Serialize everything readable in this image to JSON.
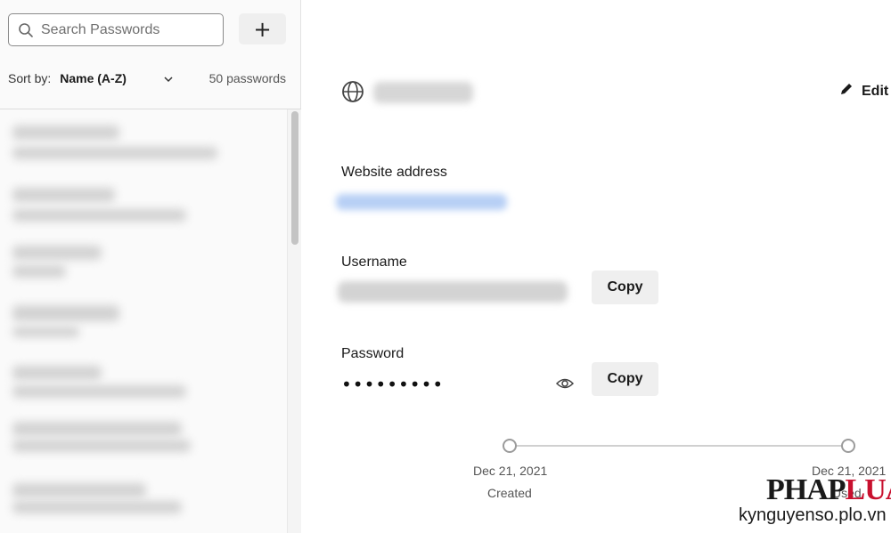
{
  "sidebar": {
    "search": {
      "placeholder": "Search Passwords"
    },
    "add_label": "+",
    "sort_label": "Sort by:",
    "sort_value": "Name (A-Z)",
    "password_count": "50 passwords"
  },
  "detail": {
    "edit_label": "Edit",
    "website_label": "Website address",
    "username_label": "Username",
    "password_label": "Password",
    "password_masked": "•••••••••",
    "copy_label": "Copy",
    "timeline": [
      {
        "date": "Dec 21, 2021",
        "caption": "Created"
      },
      {
        "date": "Dec 21, 2021",
        "caption": "Used"
      }
    ]
  },
  "watermark": {
    "logo_part1": "PHAP",
    "logo_part2": "LUAT",
    "site": "kynguyenso.plo.vn"
  },
  "colors": {
    "accent_link": "#b7cff5",
    "button_bg": "#efefef",
    "watermark_red": "#c8102e"
  }
}
